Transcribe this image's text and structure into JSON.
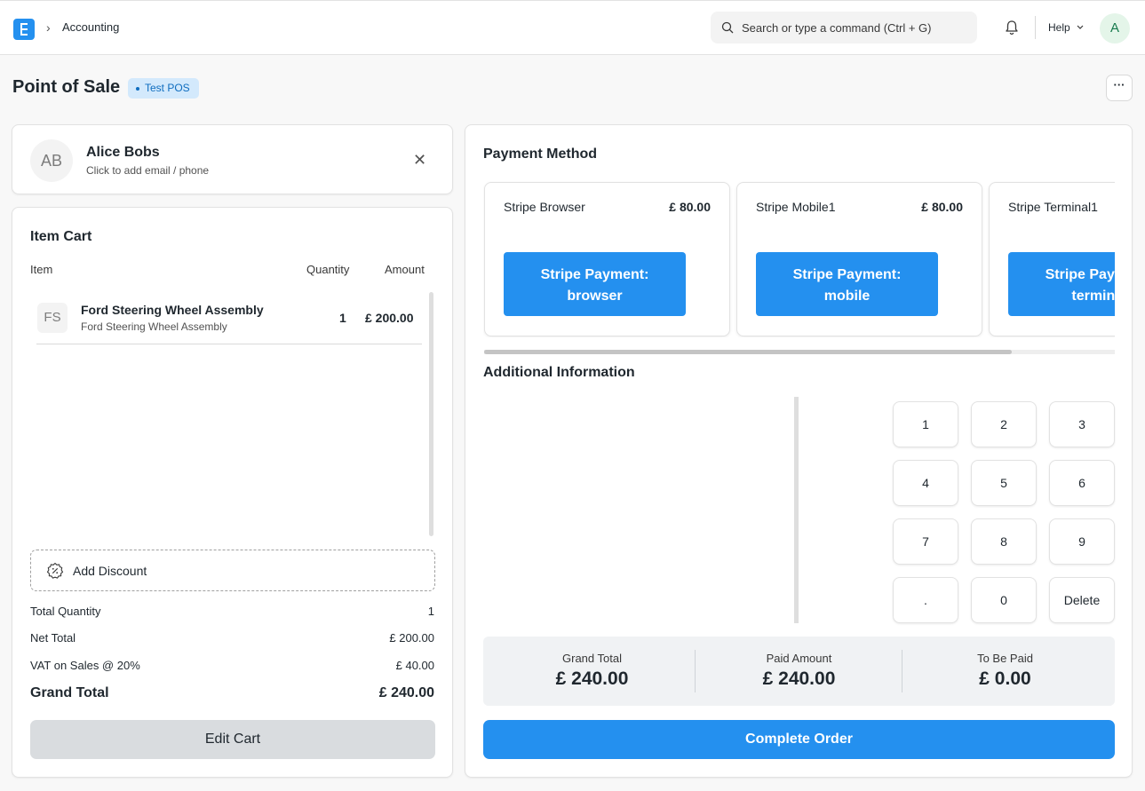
{
  "navbar": {
    "breadcrumb": "Accounting",
    "breadcrumb_separator": "›",
    "search_placeholder": "Search or type a command (Ctrl + G)",
    "help_label": "Help",
    "avatar_initial": "A"
  },
  "page": {
    "title": "Point of Sale",
    "profile_badge": "Test POS",
    "more_label": "···"
  },
  "customer": {
    "initials": "AB",
    "name": "Alice Bobs",
    "subtitle": "Click to add email / phone",
    "close_label": "✕"
  },
  "cart": {
    "title": "Item Cart",
    "columns": [
      "Item",
      "Quantity",
      "Amount"
    ],
    "items": [
      {
        "initials": "FS",
        "name": "Ford Steering Wheel Assembly",
        "description": "Ford Steering Wheel Assembly",
        "quantity": "1",
        "amount": "£ 200.00"
      }
    ],
    "discount_label": "Add Discount",
    "summary": [
      {
        "label": "Total Quantity",
        "value": "1"
      },
      {
        "label": "Net Total",
        "value": "£ 200.00"
      },
      {
        "label": "VAT on Sales @ 20%",
        "value": "£ 40.00"
      }
    ],
    "grand_total_label": "Grand Total",
    "grand_total_value": "£ 240.00",
    "edit_button": "Edit Cart"
  },
  "payment": {
    "title": "Payment Method",
    "methods": [
      {
        "name": "Stripe Browser",
        "amount": "£ 80.00",
        "button_line1": "Stripe Payment:",
        "button_line2": "browser"
      },
      {
        "name": "Stripe Mobile1",
        "amount": "£ 80.00",
        "button_line1": "Stripe Payment:",
        "button_line2": "mobile"
      },
      {
        "name": "Stripe Terminal1",
        "amount": "",
        "button_line1": "Stripe Payment:",
        "button_line2": "terminal"
      }
    ],
    "additional_info_title": "Additional Information",
    "keypad": [
      "1",
      "2",
      "3",
      "4",
      "5",
      "6",
      "7",
      "8",
      "9",
      ".",
      "0",
      "Delete"
    ],
    "totals": [
      {
        "label": "Grand Total",
        "value": "£ 240.00"
      },
      {
        "label": "Paid Amount",
        "value": "£ 240.00"
      },
      {
        "label": "To Be Paid",
        "value": "£ 0.00"
      }
    ],
    "complete_button": "Complete Order"
  },
  "colors": {
    "accent": "#2490ef",
    "badge_bg": "#d3e9fc",
    "badge_text": "#0f6dbf",
    "avatar_bg": "#e4f5e9",
    "avatar_text": "#16794c"
  }
}
